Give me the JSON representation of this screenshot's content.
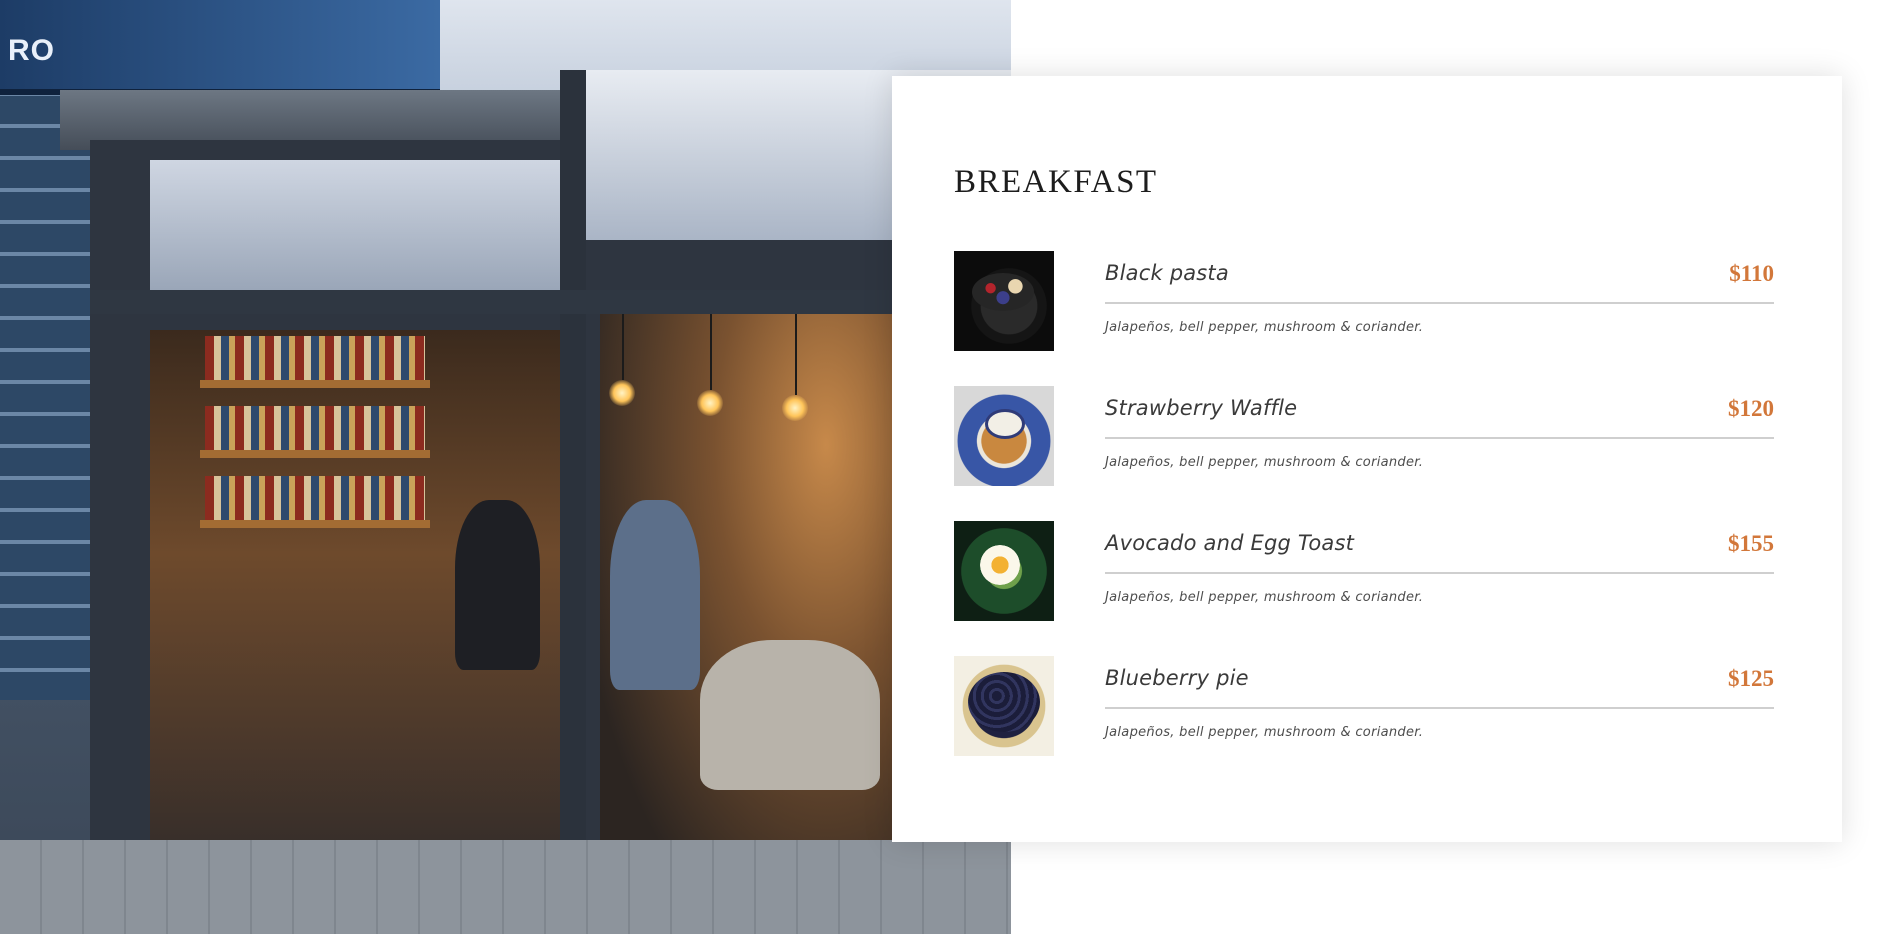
{
  "photo": {
    "alt_sign_text": "RO"
  },
  "menu": {
    "title": "BREAKFAST",
    "items": [
      {
        "name": "Black pasta",
        "price": "$110",
        "description": "Jalapeños, bell pepper, mushroom & coriander.",
        "thumb_icon": "black-pasta-photo"
      },
      {
        "name": "Strawberry Waffle",
        "price": "$120",
        "description": "Jalapeños, bell pepper, mushroom & coriander.",
        "thumb_icon": "strawberry-waffle-photo"
      },
      {
        "name": "Avocado and Egg Toast",
        "price": "$155",
        "description": "Jalapeños, bell pepper, mushroom & coriander.",
        "thumb_icon": "avocado-egg-toast-photo"
      },
      {
        "name": "Blueberry pie",
        "price": "$125",
        "description": "Jalapeños, bell pepper, mushroom & coriander.",
        "thumb_icon": "blueberry-pie-photo"
      }
    ]
  },
  "colors": {
    "price_accent": "#d2773a",
    "title_text": "#1d1d1d",
    "divider": "#cfcfcf"
  }
}
